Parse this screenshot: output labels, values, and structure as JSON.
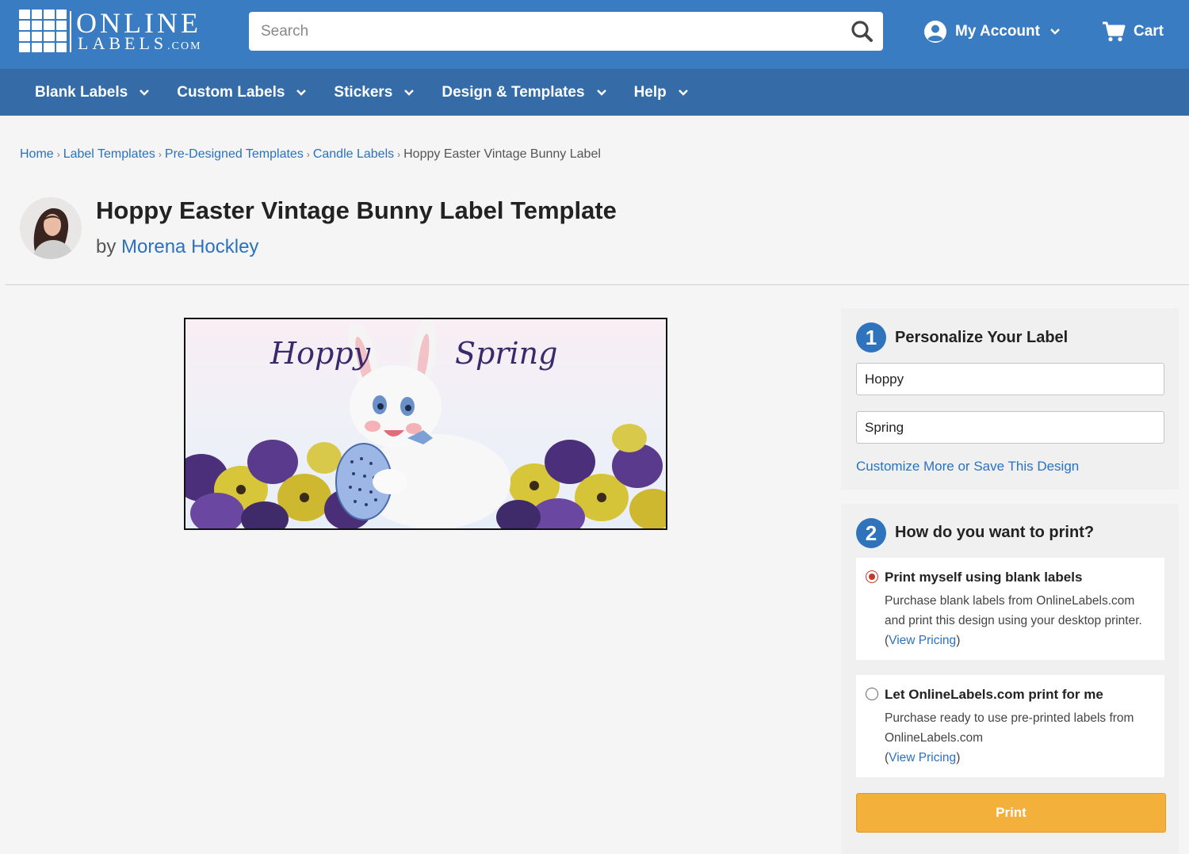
{
  "header": {
    "logo": {
      "top": "ONLINE",
      "bottom": "LABELS",
      "suffix": ".COM"
    },
    "search_placeholder": "Search",
    "account_label": "My Account",
    "cart_label": "Cart"
  },
  "nav": {
    "items": [
      {
        "label": "Blank Labels",
        "icon": "chevron-down-icon"
      },
      {
        "label": "Custom Labels",
        "icon": "chevron-down-icon"
      },
      {
        "label": "Stickers",
        "icon": "chevron-down-icon"
      },
      {
        "label": "Design & Templates",
        "icon": "chevron-down-icon"
      },
      {
        "label": "Help",
        "icon": "chevron-down-icon"
      }
    ]
  },
  "breadcrumb": {
    "items": [
      "Home",
      "Label Templates",
      "Pre-Designed Templates",
      "Candle Labels"
    ],
    "current": "Hoppy Easter Vintage Bunny Label"
  },
  "page": {
    "title": "Hoppy Easter Vintage Bunny Label Template",
    "by_prefix": "by",
    "author": "Morena Hockley"
  },
  "preview": {
    "text_left": "Hoppy",
    "text_right": "Spring"
  },
  "personalize": {
    "step": "1",
    "title": "Personalize Your Label",
    "field1_value": "Hoppy",
    "field2_value": "Spring",
    "customize_link": "Customize More or Save This Design"
  },
  "print": {
    "step": "2",
    "title": "How do you want to print?",
    "option1": {
      "title": "Print myself using blank labels",
      "desc": "Purchase blank labels from OnlineLabels.com and print this design using your desktop printer.",
      "paren_open": "(",
      "link": "View Pricing",
      "paren_close": ")",
      "selected": true
    },
    "option2": {
      "title": "Let OnlineLabels.com print for me",
      "desc": "Purchase ready to use pre-printed labels from OnlineLabels.com",
      "paren_open": "(",
      "link": "View Pricing",
      "paren_close": ")",
      "selected": false
    },
    "button_label": "Print"
  },
  "colors": {
    "header_blue": "#3a7cc1",
    "nav_blue": "#356ba6",
    "link_blue": "#2a72c0",
    "print_button": "#f3b03b",
    "radio_selected": "#c0392b",
    "preview_text_purple": "#3b2a6b"
  }
}
